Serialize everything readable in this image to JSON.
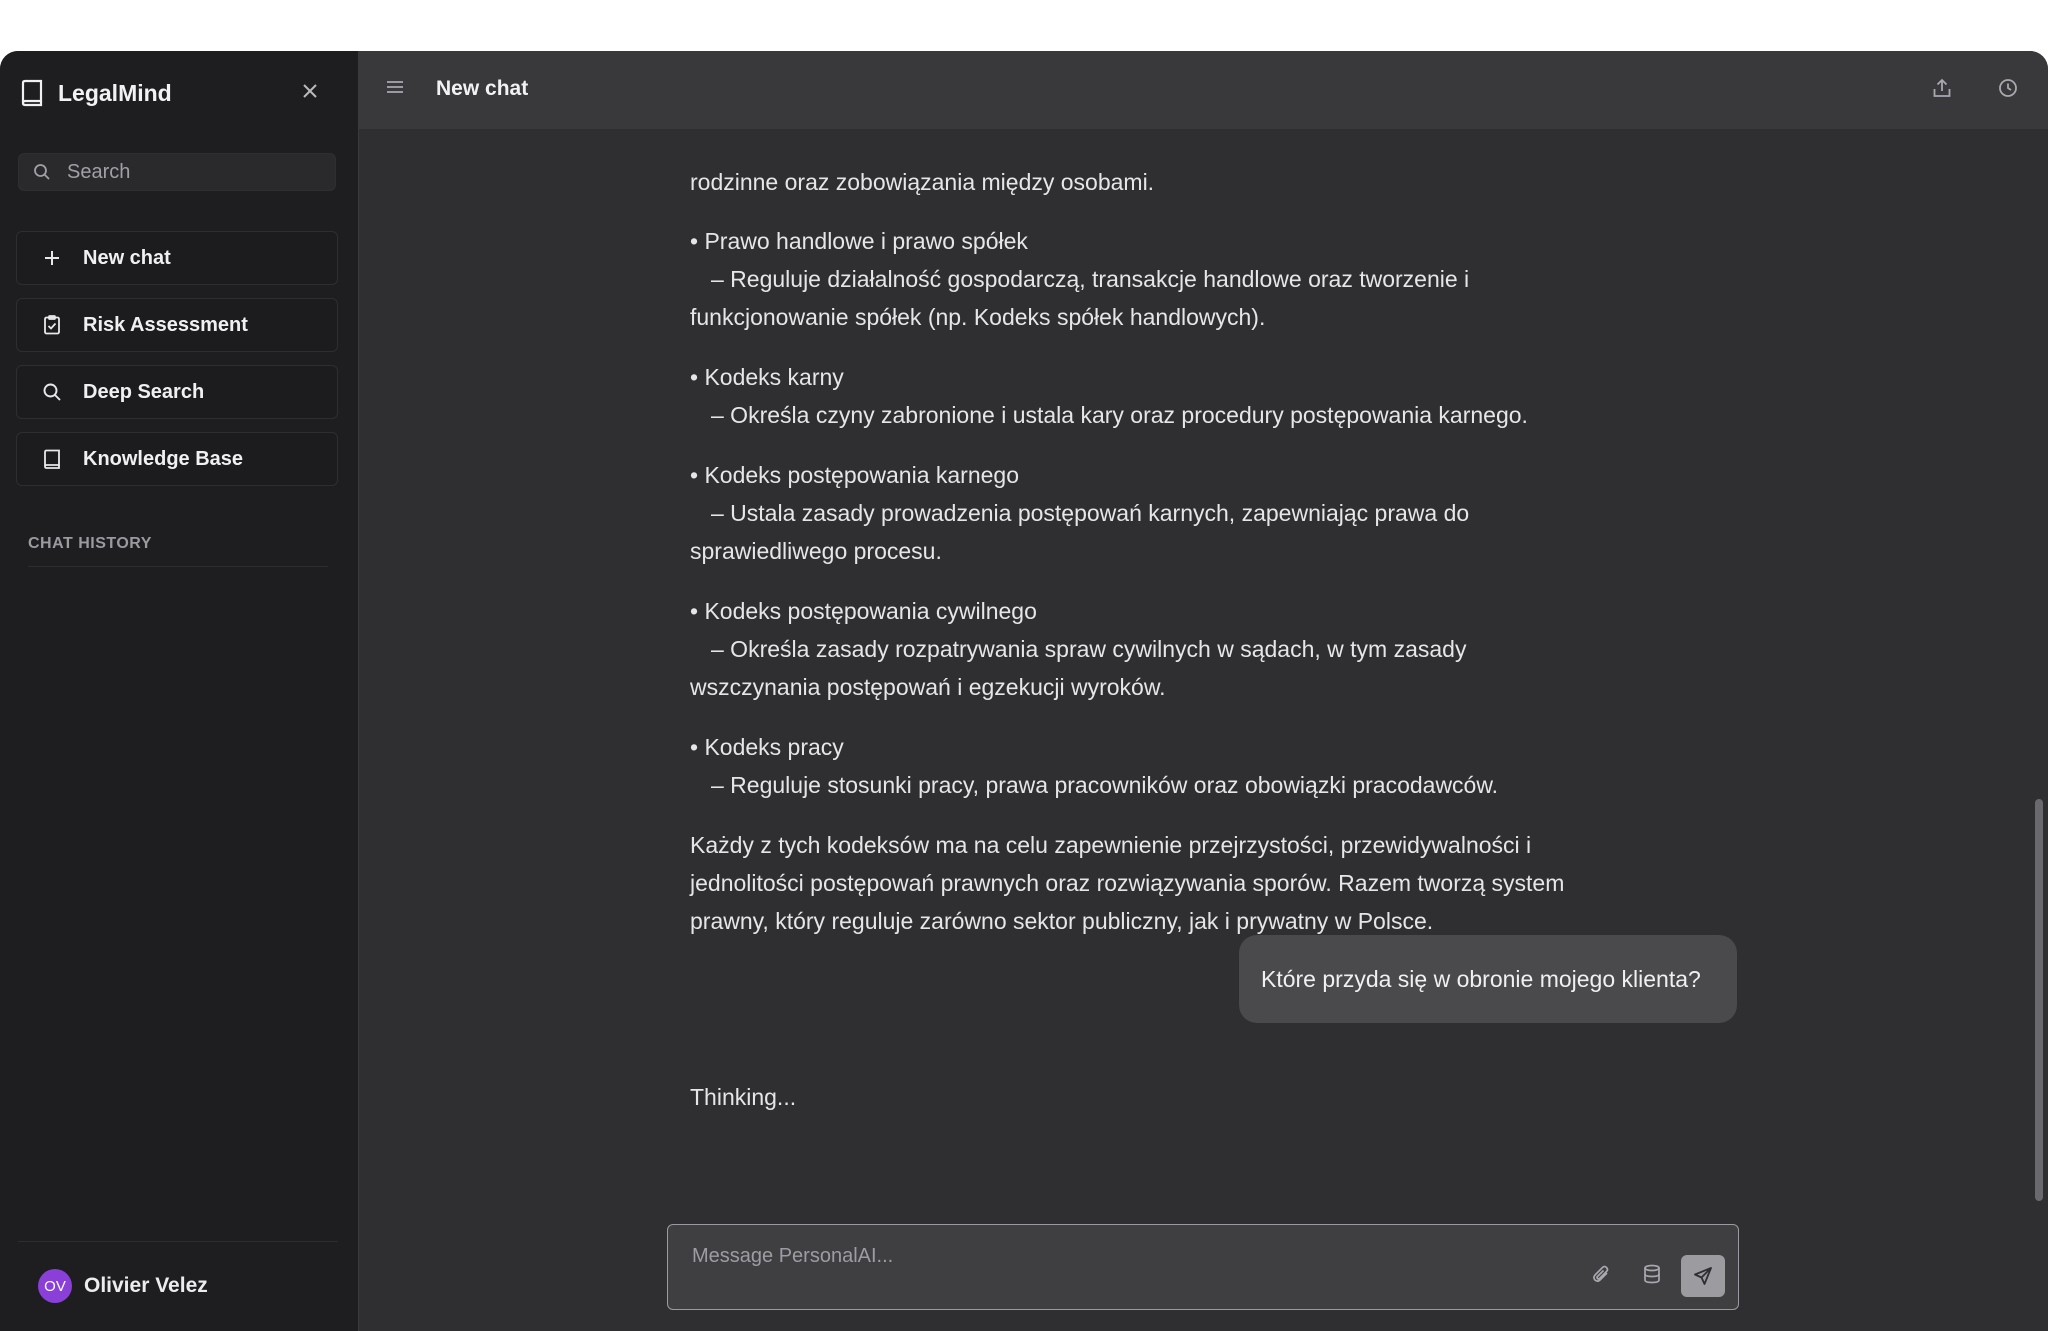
{
  "sidebar": {
    "brand": "LegalMind",
    "search_placeholder": "Search",
    "nav": [
      {
        "label": "New chat",
        "icon": "plus-icon"
      },
      {
        "label": "Risk Assessment",
        "icon": "clipboard-check-icon"
      },
      {
        "label": "Deep Search",
        "icon": "search-icon"
      },
      {
        "label": "Knowledge Base",
        "icon": "book-icon"
      }
    ],
    "history_label": "CHAT HISTORY",
    "user": {
      "initials": "OV",
      "name": "Olivier Velez",
      "avatar_color": "#8b3fd9"
    }
  },
  "header": {
    "title": "New chat"
  },
  "messages": {
    "partial_top": "rodzinne oraz zobowiązania między osobami.",
    "items": [
      {
        "title": "• Prawo handlowe i prawo spółek",
        "desc": "– Reguluje działalność gospodarczą, transakcje handlowe oraz tworzenie i",
        "cont": "funkcjonowanie spółek (np. Kodeks spółek handlowych)."
      },
      {
        "title": "• Kodeks karny",
        "desc": "– Określa czyny zabronione i ustala kary oraz procedury postępowania karnego.",
        "cont": ""
      },
      {
        "title": "• Kodeks postępowania karnego",
        "desc": "– Ustala zasady prowadzenia postępowań karnych, zapewniając prawa do",
        "cont": "sprawiedliwego procesu."
      },
      {
        "title": "• Kodeks postępowania cywilnego",
        "desc": "– Określa zasady rozpatrywania spraw cywilnych w sądach, w tym zasady",
        "cont": "wszczynania postępowań i egzekucji wyroków."
      },
      {
        "title": "• Kodeks pracy",
        "desc": "– Reguluje stosunki pracy, prawa pracowników oraz obowiązki pracodawców.",
        "cont": ""
      }
    ],
    "summary": [
      "Każdy z tych kodeksów ma na celu zapewnienie przejrzystości, przewidywalności i",
      "jednolitości postępowań prawnych oraz rozwiązywania sporów. Razem tworzą system",
      "prawny, który reguluje zarówno sektor publiczny, jak i prywatny w Polsce."
    ],
    "user_message": "Które przyda się w obronie mojego klienta?",
    "thinking": "Thinking..."
  },
  "composer": {
    "placeholder": "Message PersonalAI..."
  }
}
